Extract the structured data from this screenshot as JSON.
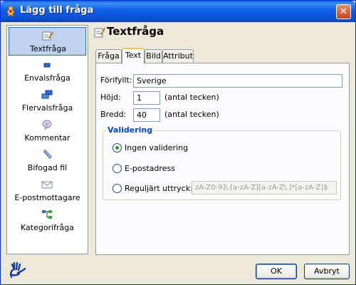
{
  "window": {
    "title": "Lägg till fråga",
    "close_glyph": "✕"
  },
  "sidebar": {
    "items": [
      {
        "label": "Textfråga",
        "icon": "text-question-icon",
        "selected": true
      },
      {
        "label": "Envalsfråga",
        "icon": "single-choice-icon",
        "selected": false
      },
      {
        "label": "Flervalsfråga",
        "icon": "multiple-choice-icon",
        "selected": false
      },
      {
        "label": "Kommentar",
        "icon": "comment-icon",
        "selected": false
      },
      {
        "label": "Bifogad fil",
        "icon": "paperclip-icon",
        "selected": false
      },
      {
        "label": "E-postmottagare",
        "icon": "envelope-icon",
        "selected": false
      },
      {
        "label": "Kategorifråga",
        "icon": "category-icon",
        "selected": false
      }
    ]
  },
  "header": {
    "title": "Textfråga",
    "icon": "text-question-icon"
  },
  "tabs": [
    {
      "label": "Fråga",
      "active": false
    },
    {
      "label": "Text",
      "active": true
    },
    {
      "label": "Bild",
      "active": false
    },
    {
      "label": "Attribut",
      "active": false
    }
  ],
  "form": {
    "prefilled": {
      "label": "Förifyllt:",
      "value": "Sverige"
    },
    "height": {
      "label": "Höjd:",
      "value": "1",
      "unit": "(antal tecken)"
    },
    "width": {
      "label": "Bredd:",
      "value": "40",
      "unit": "(antal tecken)"
    }
  },
  "validation": {
    "legend": "Validering",
    "options": [
      {
        "label": "Ingen validering",
        "checked": true
      },
      {
        "label": "E-postadress",
        "checked": false
      },
      {
        "label": "Reguljärt uttryck:",
        "checked": false
      }
    ],
    "regex_value": "zA-Z0-9]\\.[a-zA-Z][a-zA-Z\\.]*[a-zA-Z]$"
  },
  "buttons": {
    "ok": "OK",
    "cancel": "Avbryt"
  },
  "colors": {
    "titlebar": "#0b52d8",
    "selection": "#c1d2ee",
    "legend": "#0046d5",
    "radio_dot": "#21a121"
  }
}
